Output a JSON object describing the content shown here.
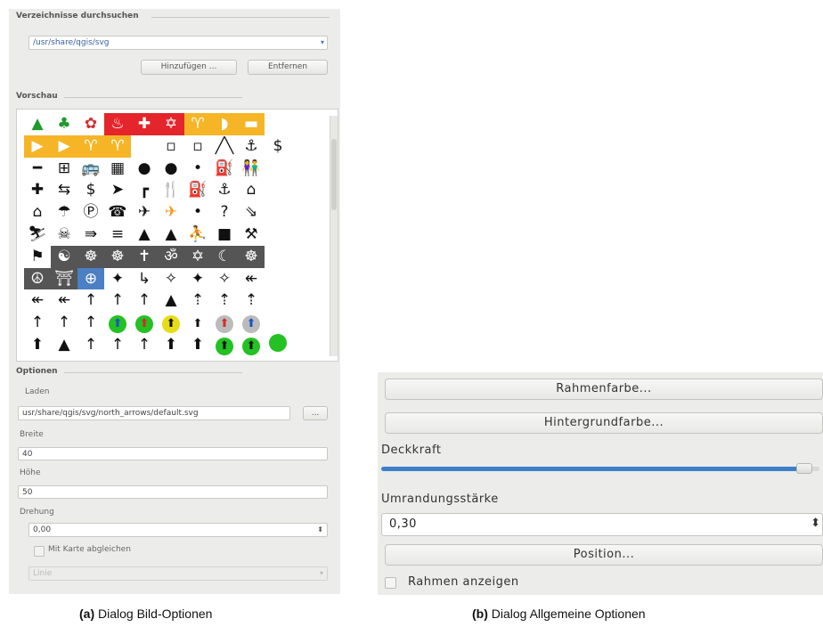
{
  "dialog_a": {
    "directories_title": "Verzeichnisse durchsuchen",
    "directory_value": "/usr/share/qgis/svg",
    "add_label": "Hinzufügen ...",
    "remove_label": "Entfernen",
    "preview_title": "Vorschau",
    "preview_symbols": [
      "▲",
      "♣",
      "✿",
      "♨",
      "✚",
      "✡",
      "♈",
      "◗",
      "▬",
      "",
      "",
      "▶",
      "▶",
      "♈",
      "♈",
      "",
      "▫",
      "▫",
      "╱╲",
      "⚓",
      "$",
      "",
      "━",
      "⊞",
      "🚌",
      "▦",
      "●",
      "●",
      "•",
      "⛽",
      "👫",
      "",
      "",
      "✚",
      "⇆",
      "$",
      "➤",
      "┏",
      "🍴",
      "⛽",
      "⚓",
      "⌂",
      "",
      "",
      "⌂",
      "☂",
      "Ⓟ",
      "☎",
      "✈",
      "✈",
      "•",
      "?",
      "⇘",
      "",
      "",
      "⛷",
      "☠",
      "⇛",
      "≡",
      "▲",
      "▲",
      "⛹",
      "■",
      "⚒",
      "",
      "",
      "⚑",
      "☯",
      "☸",
      "☸",
      "✝",
      "ॐ",
      "✡",
      "☾",
      "☸",
      "",
      "",
      "☮",
      "⛩",
      "⊕",
      "✦",
      "↳",
      "✧",
      "✦",
      "✧",
      "↞",
      "",
      "",
      "↞",
      "↞",
      "↑",
      "↑",
      "↑",
      "▲",
      "⇡",
      "⇡",
      "⇡",
      "",
      "",
      "↑",
      "↑",
      "↑",
      "⬆",
      "⬆",
      "⬆",
      "⬆",
      "⬆",
      "⬆",
      "",
      "",
      "⬆",
      "▲",
      "↑",
      "↑",
      "↑",
      "⬆",
      "⬆",
      "⬆",
      "⬆",
      "",
      ""
    ],
    "options_title": "Optionen",
    "load_label": "Laden",
    "load_value": "usr/share/qgis/svg/north_arrows/default.svg",
    "browse_label": "...",
    "width_label": "Breite",
    "width_value": "40",
    "height_label": "Höhe",
    "height_value": "50",
    "rotation_label": "Drehung",
    "rotation_value": "0,00",
    "sync_label": "Mit Karte abgleichen",
    "combo_value": "Linie"
  },
  "dialog_b": {
    "frame_color_label": "Rahmenfarbe...",
    "background_color_label": "Hintergrundfarbe...",
    "opacity_label": "Deckkraft",
    "opacity_value": 0.98,
    "outline_label": "Umrandungsstärke",
    "outline_value": "0,30",
    "position_label": "Position...",
    "show_frame_label": "Rahmen anzeigen"
  },
  "captions": {
    "a_prefix": "(a)",
    "a_text": " Dialog Bild-Optionen",
    "b_prefix": "(b)",
    "b_text": " Dialog Allgemeine Optionen"
  },
  "colors": {
    "accent": "#3d80c9",
    "panel_bg": "#ececea"
  }
}
